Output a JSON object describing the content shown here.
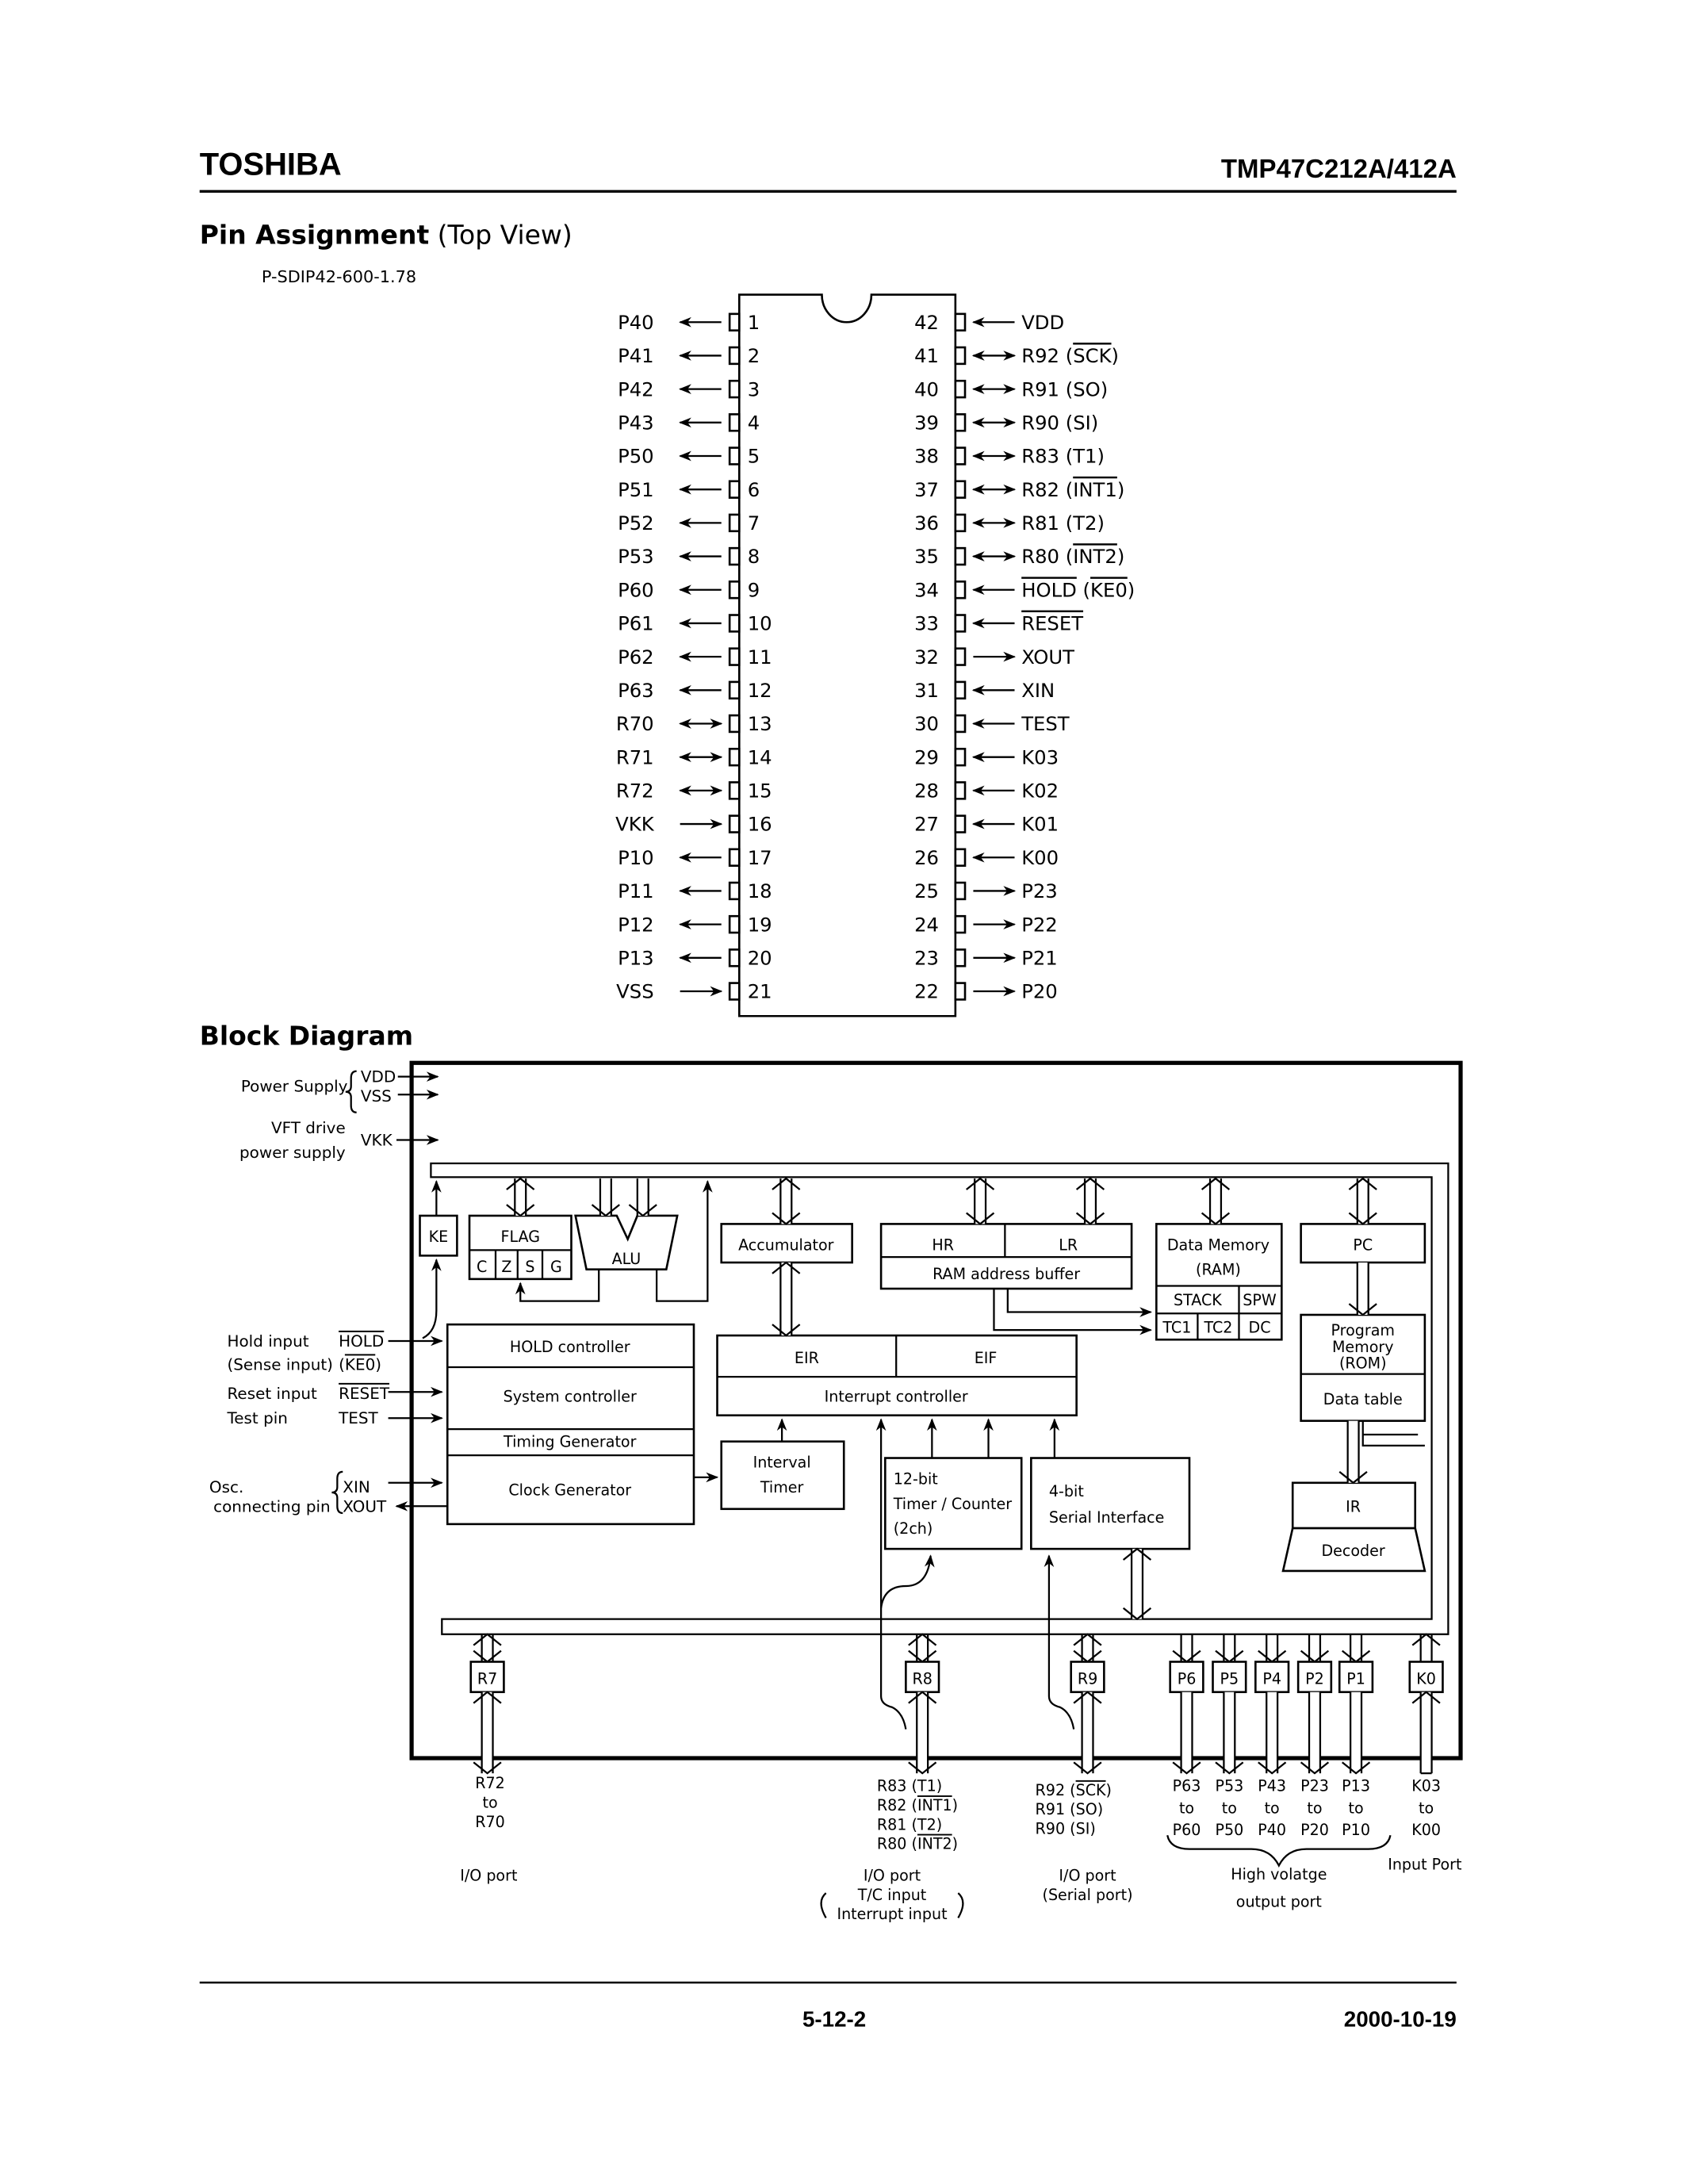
{
  "header": {
    "brand": "TOSHIBA",
    "part_number": "TMP47C212A/412A"
  },
  "pin_assignment": {
    "title_bold": "Pin Assignment",
    "title_normal": "(Top View)",
    "package": "P-SDIP42-600-1.78",
    "left_pins": [
      {
        "num": "1",
        "name": "P40",
        "dir": "out"
      },
      {
        "num": "2",
        "name": "P41",
        "dir": "out"
      },
      {
        "num": "3",
        "name": "P42",
        "dir": "out"
      },
      {
        "num": "4",
        "name": "P43",
        "dir": "out"
      },
      {
        "num": "5",
        "name": "P50",
        "dir": "out"
      },
      {
        "num": "6",
        "name": "P51",
        "dir": "out"
      },
      {
        "num": "7",
        "name": "P52",
        "dir": "out"
      },
      {
        "num": "8",
        "name": "P53",
        "dir": "out"
      },
      {
        "num": "9",
        "name": "P60",
        "dir": "out"
      },
      {
        "num": "10",
        "name": "P61",
        "dir": "out"
      },
      {
        "num": "11",
        "name": "P62",
        "dir": "out"
      },
      {
        "num": "12",
        "name": "P63",
        "dir": "out"
      },
      {
        "num": "13",
        "name": "R70",
        "dir": "bi"
      },
      {
        "num": "14",
        "name": "R71",
        "dir": "bi"
      },
      {
        "num": "15",
        "name": "R72",
        "dir": "bi"
      },
      {
        "num": "16",
        "name": "VKK",
        "dir": "in"
      },
      {
        "num": "17",
        "name": "P10",
        "dir": "out"
      },
      {
        "num": "18",
        "name": "P11",
        "dir": "out"
      },
      {
        "num": "19",
        "name": "P12",
        "dir": "out"
      },
      {
        "num": "20",
        "name": "P13",
        "dir": "out"
      },
      {
        "num": "21",
        "name": "VSS",
        "dir": "in"
      }
    ],
    "right_pins": [
      {
        "num": "42",
        "name": "VDD",
        "dir": "in"
      },
      {
        "num": "41",
        "name": "R92 (SCK)",
        "dir": "bi"
      },
      {
        "num": "40",
        "name": "R91 (SO)",
        "dir": "bi"
      },
      {
        "num": "39",
        "name": "R90 (SI)",
        "dir": "bi"
      },
      {
        "num": "38",
        "name": "R83 (T1)",
        "dir": "bi"
      },
      {
        "num": "37",
        "name": "R82 (INT1)",
        "dir": "bi"
      },
      {
        "num": "36",
        "name": "R81 (T2)",
        "dir": "bi"
      },
      {
        "num": "35",
        "name": "R80 (INT2)",
        "dir": "bi"
      },
      {
        "num": "34",
        "name": "HOLD (KE0)",
        "dir": "in"
      },
      {
        "num": "33",
        "name": "RESET",
        "dir": "in"
      },
      {
        "num": "32",
        "name": "XOUT",
        "dir": "out"
      },
      {
        "num": "31",
        "name": "XIN",
        "dir": "in"
      },
      {
        "num": "30",
        "name": "TEST",
        "dir": "in"
      },
      {
        "num": "29",
        "name": "K03",
        "dir": "in"
      },
      {
        "num": "28",
        "name": "K02",
        "dir": "in"
      },
      {
        "num": "27",
        "name": "K01",
        "dir": "in"
      },
      {
        "num": "26",
        "name": "K00",
        "dir": "in"
      },
      {
        "num": "25",
        "name": "P23",
        "dir": "out"
      },
      {
        "num": "24",
        "name": "P22",
        "dir": "out"
      },
      {
        "num": "23",
        "name": "P21",
        "dir": "out"
      },
      {
        "num": "22",
        "name": "P20",
        "dir": "out"
      }
    ]
  },
  "block_diagram": {
    "title": "Block Diagram",
    "left_labels": {
      "power_supply": "Power Supply",
      "vdd": "VDD",
      "vss": "VSS",
      "vft_drive": "VFT drive",
      "power_supply_lower": "power supply",
      "vkk": "VKK",
      "hold_input": "Hold input",
      "hold": "HOLD",
      "sense_input": "(Sense input)",
      "ke0_open": "(",
      "ke0": "KE0",
      "ke0_close": ")",
      "reset_input": "Reset input",
      "reset": "RESET",
      "test_pin": "Test pin",
      "test": "TEST",
      "osc": "Osc.",
      "connecting_pin": "connecting pin",
      "xin": "XIN",
      "xout": "XOUT"
    },
    "blocks": {
      "ke": "KE",
      "flag": "FLAG",
      "flag_bits": [
        "C",
        "Z",
        "S",
        "G"
      ],
      "alu": "ALU",
      "accumulator": "Accumulator",
      "hr": "HR",
      "lr": "LR",
      "ram_address_buffer": "RAM address buffer",
      "data_memory": "Data Memory",
      "ram": "(RAM)",
      "stack": "STACK",
      "spw": "SPW",
      "tc1": "TC1",
      "tc2": "TC2",
      "dc": "DC",
      "pc": "PC",
      "program_memory_1": "Program",
      "program_memory_2": "Memory",
      "program_memory_3": "(ROM)",
      "data_table": "Data table",
      "hold_controller": "HOLD controller",
      "system_controller": "System controller",
      "timing_generator": "Timing Generator",
      "clock_generator": "Clock Generator",
      "eir": "EIR",
      "eif": "EIF",
      "interrupt_controller": "Interrupt controller",
      "interval_timer_1": "Interval",
      "interval_timer_2": "Timer",
      "timer_counter_1": "12-bit",
      "timer_counter_2": "Timer / Counter",
      "timer_counter_3": "(2ch)",
      "serial_1": "4-bit",
      "serial_2": "Serial  Interface",
      "ir": "IR",
      "decoder": "Decoder"
    },
    "ports": [
      "R7",
      "R8",
      "R9",
      "P6",
      "P5",
      "P4",
      "P2",
      "P1",
      "K0"
    ],
    "bottom_labels": {
      "r7": [
        "R72",
        "to",
        "R70"
      ],
      "r7_desc": "I/O port",
      "r8": [
        "R83 (T1)",
        "R82 (INT1)",
        "R81 (T2)",
        "R80 (INT2)"
      ],
      "r8_desc": [
        "I/O port",
        "T/C input",
        "Interrupt input"
      ],
      "r9": [
        "R92 (SCK)",
        "R91 (SO)",
        "R90 (SI)"
      ],
      "r9_desc": [
        "I/O port",
        "(Serial port)"
      ],
      "p6": [
        "P63",
        "to",
        "P60"
      ],
      "p5": [
        "P53",
        "to",
        "P50"
      ],
      "p4": [
        "P43",
        "to",
        "P40"
      ],
      "p2": [
        "P23",
        "to",
        "P20"
      ],
      "p1": [
        "P13",
        "to",
        "P10"
      ],
      "k0": [
        "K03",
        "to",
        "K00"
      ],
      "hv_desc": [
        "High volatge",
        "output port"
      ],
      "input_desc": "Input Port"
    }
  },
  "footer": {
    "page": "5-12-2",
    "date": "2000-10-19"
  }
}
